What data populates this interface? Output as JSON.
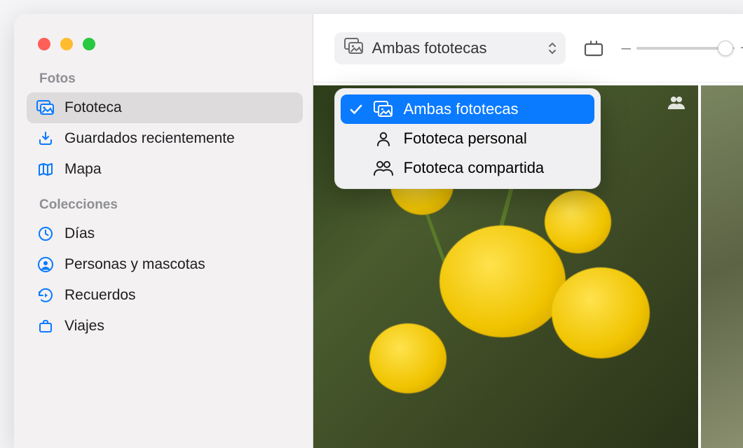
{
  "sidebar": {
    "sections": [
      {
        "header": "Fotos",
        "items": [
          {
            "label": "Fototeca",
            "icon": "library-icon",
            "selected": true
          },
          {
            "label": "Guardados recientemente",
            "icon": "download-icon",
            "selected": false
          },
          {
            "label": "Mapa",
            "icon": "map-icon",
            "selected": false
          }
        ]
      },
      {
        "header": "Colecciones",
        "items": [
          {
            "label": "Días",
            "icon": "clock-icon",
            "selected": false
          },
          {
            "label": "Personas y mascotas",
            "icon": "person-circle-icon",
            "selected": false
          },
          {
            "label": "Recuerdos",
            "icon": "rewind-icon",
            "selected": false
          },
          {
            "label": "Viajes",
            "icon": "suitcase-icon",
            "selected": false
          }
        ]
      }
    ]
  },
  "toolbar": {
    "library_selector": {
      "selected_label": "Ambas fototecas",
      "icon": "library-icon"
    },
    "zoom": {
      "min_label": "–",
      "plus_label": "+"
    }
  },
  "dropdown": {
    "items": [
      {
        "label": "Ambas fototecas",
        "icon": "library-icon",
        "selected": true
      },
      {
        "label": "Fototeca personal",
        "icon": "person-icon",
        "selected": false
      },
      {
        "label": "Fototeca compartida",
        "icon": "two-person-icon",
        "selected": false
      }
    ]
  },
  "colors": {
    "accent_blue": "#0a7aff",
    "sidebar_bg": "#f3f1f2",
    "selected_row": "#dddbdc",
    "icon_blue": "#0a7aff"
  }
}
